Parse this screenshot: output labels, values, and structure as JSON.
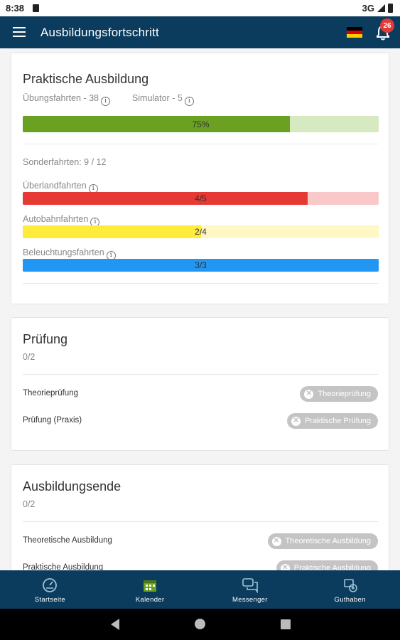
{
  "status_bar": {
    "time": "8:38",
    "network": "3G"
  },
  "app_bar": {
    "title": "Ausbildungsfortschritt",
    "notification_count": "26"
  },
  "practical": {
    "title": "Praktische Ausbildung",
    "uebungsfahrten": "Übungsfahrten - 38",
    "simulator": "Simulator - 5",
    "overall_progress": {
      "label": "75%",
      "value": 0.75,
      "color": "#6aa121",
      "bg": "#d7e9c1"
    },
    "sonderfahrten": "Sonderfahrten: 9 / 12",
    "categories": [
      {
        "name": "Überlandfahrten",
        "label": "4/5",
        "value": 0.8,
        "color": "#e53935",
        "bg": "#f8c9c8"
      },
      {
        "name": "Autobahnfahrten",
        "label": "2/4",
        "value": 0.5,
        "color": "#ffeb3b",
        "bg": "#fff7c4"
      },
      {
        "name": "Beleuchtungsfahrten",
        "label": "3/3",
        "value": 1.0,
        "color": "#2196f3",
        "bg": "#bbdefb"
      }
    ]
  },
  "exam": {
    "title": "Prüfung",
    "count": "0/2",
    "rows": [
      {
        "label": "Theorieprüfung",
        "chip": "Theorieprüfung"
      },
      {
        "label": "Prüfung (Praxis)",
        "chip": "Praktische Prüfung"
      }
    ]
  },
  "end": {
    "title": "Ausbildungsende",
    "count": "0/2",
    "rows": [
      {
        "label": "Theoretische Ausbildung",
        "chip": "Theoretische Ausbildung"
      },
      {
        "label": "Praktische Ausbildung",
        "chip": "Praktische Ausbildung"
      }
    ]
  },
  "bottom_nav": [
    {
      "label": "Startseite",
      "icon": "speedometer-icon"
    },
    {
      "label": "Kalender",
      "icon": "calendar-icon"
    },
    {
      "label": "Messenger",
      "icon": "chat-icon"
    },
    {
      "label": "Guthaben",
      "icon": "wallet-icon"
    }
  ],
  "colors": {
    "primary": "#0b3c5d",
    "badge": "#e53935",
    "chip": "#c4c4c4"
  }
}
